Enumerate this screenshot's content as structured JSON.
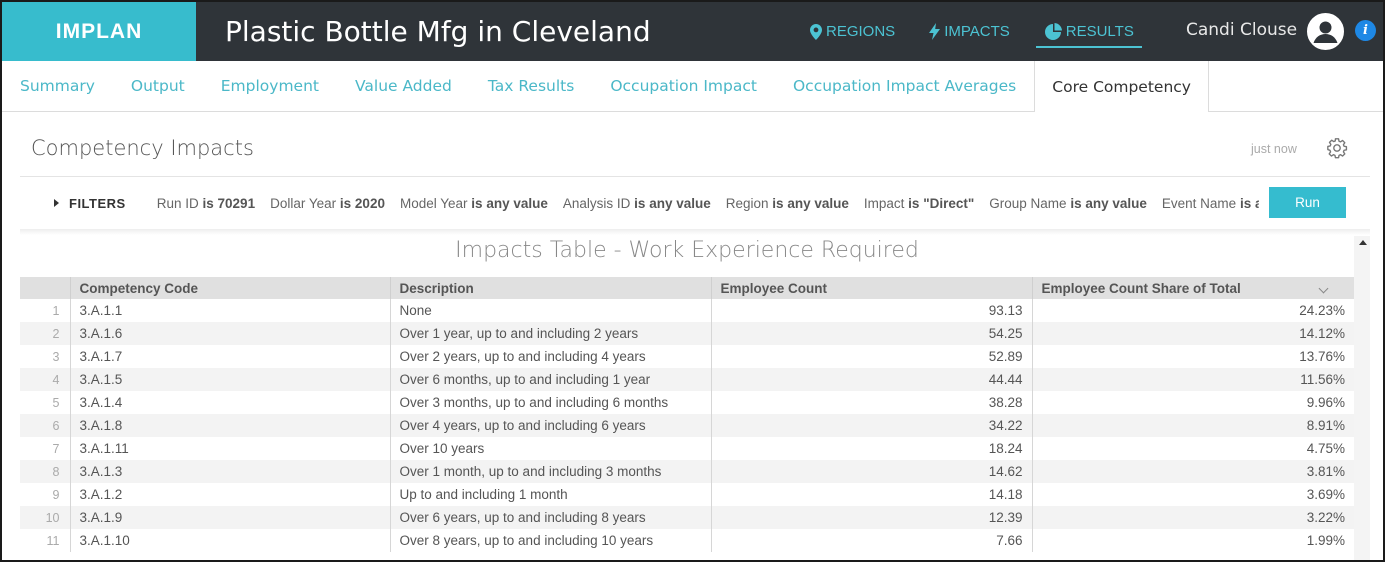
{
  "header": {
    "logo": "IMPLAN",
    "title": "Plastic Bottle Mfg in Cleveland",
    "nav": [
      {
        "label": "REGIONS",
        "icon": "map-pin-icon"
      },
      {
        "label": "IMPACTS",
        "icon": "lightning-icon"
      },
      {
        "label": "RESULTS",
        "icon": "pie-chart-icon",
        "active": true
      }
    ],
    "user_name": "Candi Clouse",
    "info_glyph": "i"
  },
  "tabs": [
    {
      "label": "Summary"
    },
    {
      "label": "Output"
    },
    {
      "label": "Employment"
    },
    {
      "label": "Value Added"
    },
    {
      "label": "Tax Results"
    },
    {
      "label": "Occupation Impact"
    },
    {
      "label": "Occupation Impact Averages"
    },
    {
      "label": "Core Competency",
      "active": true
    }
  ],
  "panel": {
    "title": "Competency Impacts",
    "updated": "just now"
  },
  "filters": {
    "label": "FILTERS",
    "items": [
      {
        "field": "Run ID",
        "op": "is",
        "value": "70291"
      },
      {
        "field": "Dollar Year",
        "op": "is",
        "value": "2020"
      },
      {
        "field": "Model Year",
        "op": "is",
        "value": "any value"
      },
      {
        "field": "Analysis ID",
        "op": "is",
        "value": "any value"
      },
      {
        "field": "Region",
        "op": "is",
        "value": "any value"
      },
      {
        "field": "Impact",
        "op": "is",
        "value": "\"Direct\""
      },
      {
        "field": "Group Name",
        "op": "is",
        "value": "any value"
      },
      {
        "field": "Event Name",
        "op": "is",
        "value": "a"
      }
    ],
    "run_label": "Run"
  },
  "table": {
    "title": "Impacts Table - Work Experience Required",
    "columns": [
      "Competency Code",
      "Description",
      "Employee Count",
      "Employee Count Share of Total"
    ],
    "rows": [
      {
        "n": "1",
        "code": "3.A.1.1",
        "desc": "None",
        "count": "93.13",
        "share": "24.23%"
      },
      {
        "n": "2",
        "code": "3.A.1.6",
        "desc": "Over 1 year, up to and including 2 years",
        "count": "54.25",
        "share": "14.12%"
      },
      {
        "n": "3",
        "code": "3.A.1.7",
        "desc": "Over 2 years, up to and including 4 years",
        "count": "52.89",
        "share": "13.76%"
      },
      {
        "n": "4",
        "code": "3.A.1.5",
        "desc": "Over 6 months, up to and including 1 year",
        "count": "44.44",
        "share": "11.56%"
      },
      {
        "n": "5",
        "code": "3.A.1.4",
        "desc": "Over 3 months, up to and including 6 months",
        "count": "38.28",
        "share": "9.96%"
      },
      {
        "n": "6",
        "code": "3.A.1.8",
        "desc": "Over 4 years, up to and including 6 years",
        "count": "34.22",
        "share": "8.91%"
      },
      {
        "n": "7",
        "code": "3.A.1.11",
        "desc": "Over 10 years",
        "count": "18.24",
        "share": "4.75%"
      },
      {
        "n": "8",
        "code": "3.A.1.3",
        "desc": "Over 1 month, up to and including 3 months",
        "count": "14.62",
        "share": "3.81%"
      },
      {
        "n": "9",
        "code": "3.A.1.2",
        "desc": "Up to and including 1 month",
        "count": "14.18",
        "share": "3.69%"
      },
      {
        "n": "10",
        "code": "3.A.1.9",
        "desc": "Over 6 years, up to and including 8 years",
        "count": "12.39",
        "share": "3.22%"
      },
      {
        "n": "11",
        "code": "3.A.1.10",
        "desc": "Over 8 years, up to and including 10 years",
        "count": "7.66",
        "share": "1.99%"
      }
    ]
  }
}
